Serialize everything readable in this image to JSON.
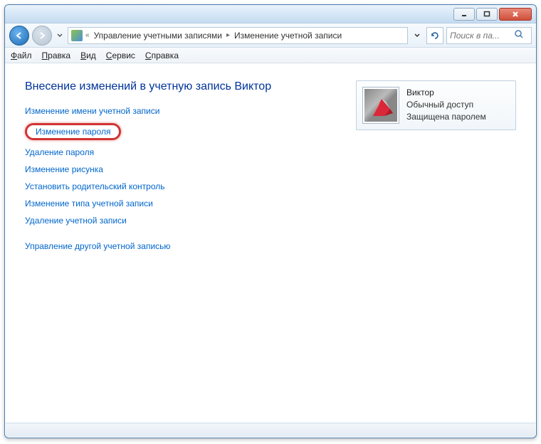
{
  "titlebar": {
    "minimize": "minimize",
    "maximize": "maximize",
    "close": "close"
  },
  "breadcrumb": {
    "prefix": "«",
    "seg1": "Управление учетными записями",
    "seg2": "Изменение учетной записи"
  },
  "search": {
    "placeholder": "Поиск в па..."
  },
  "menu": {
    "file": "айл",
    "file_u": "Ф",
    "edit": "равка",
    "edit_u": "П",
    "view": "ид",
    "view_u": "В",
    "tools": "ервис",
    "tools_u": "С",
    "help": "правка",
    "help_u": "С"
  },
  "page": {
    "title": "Внесение изменений в учетную запись Виктор"
  },
  "tasks": {
    "rename": "Изменение имени учетной записи",
    "change_pw": "Изменение пароля",
    "delete_pw": "Удаление пароля",
    "change_pic": "Изменение рисунка",
    "parental": "Установить родительский контроль",
    "change_type": "Изменение типа учетной записи",
    "delete_acc": "Удаление учетной записи",
    "manage_other": "Управление другой учетной записью"
  },
  "user": {
    "name": "Виктор",
    "access": "Обычный доступ",
    "protected": "Защищена паролем"
  }
}
